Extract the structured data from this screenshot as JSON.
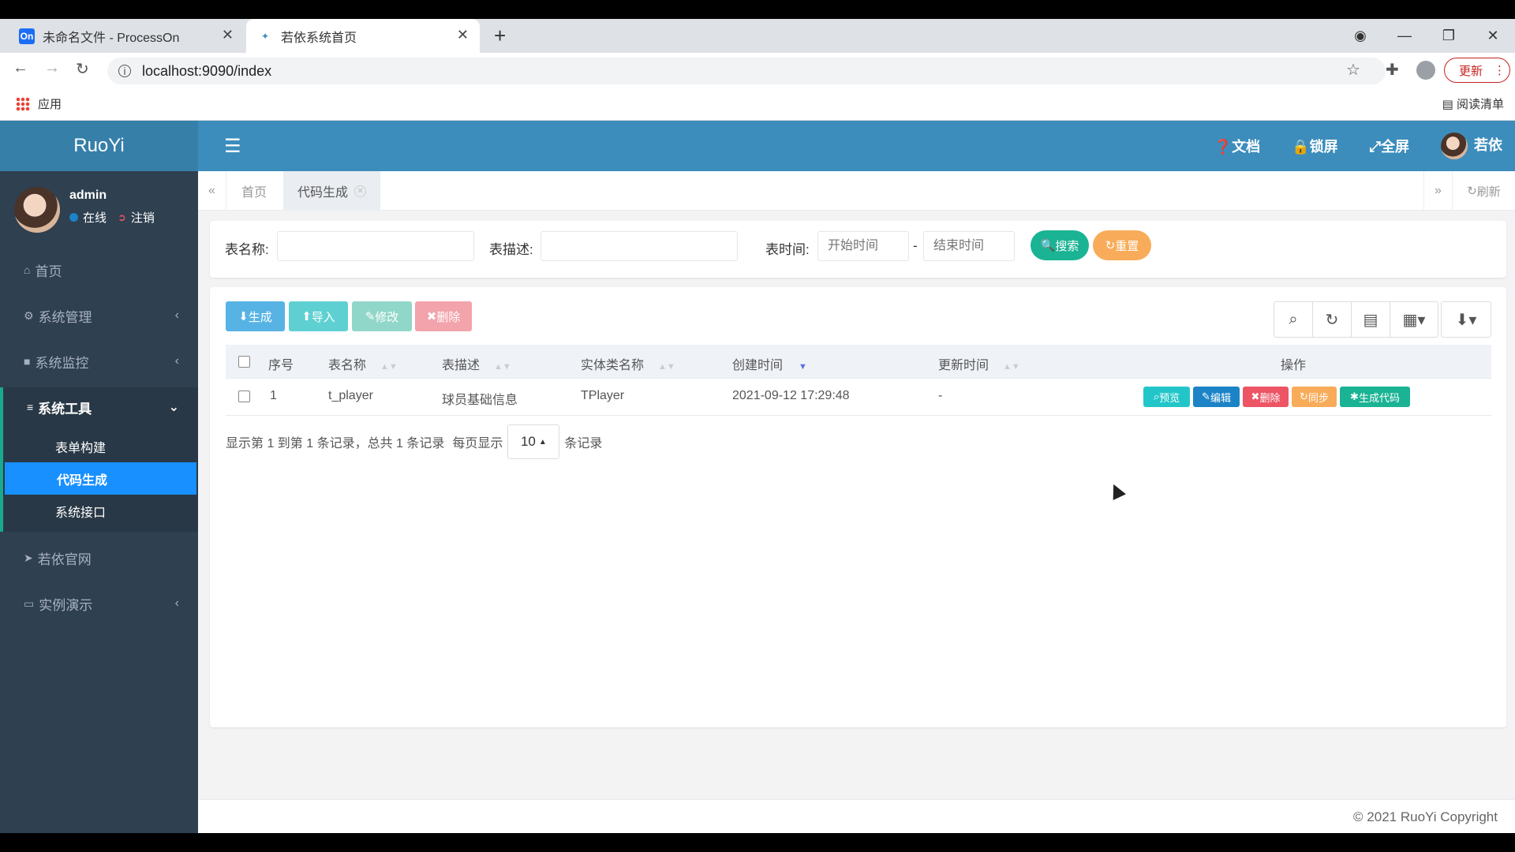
{
  "browser": {
    "tabs": [
      {
        "favicon": "On",
        "title": "未命名文件 - ProcessOn"
      },
      {
        "favicon": "✦",
        "title": "若依系统首页"
      }
    ],
    "url": "localhost:9090/index",
    "update_label": "更新",
    "bookmarks": {
      "apps": "应用",
      "reading_list": "阅读清单"
    }
  },
  "app": {
    "logo": "RuoYi",
    "user": {
      "name": "admin",
      "online": "在线",
      "logout": "注销"
    },
    "menu": [
      {
        "icon": "⌂",
        "label": "首页",
        "arrow": ""
      },
      {
        "icon": "⚙",
        "label": "系统管理",
        "arrow": "‹"
      },
      {
        "icon": "■",
        "label": "系统监控",
        "arrow": "‹"
      },
      {
        "icon": "≡",
        "label": "系统工具",
        "arrow": "⌄"
      },
      {
        "icon": "➤",
        "label": "若依官网",
        "arrow": ""
      },
      {
        "icon": "▭",
        "label": "实例演示",
        "arrow": "‹"
      }
    ],
    "submenu": [
      "表单构建",
      "代码生成",
      "系统接口"
    ],
    "topbar": {
      "docs": "文档",
      "lock": "锁屏",
      "fullscreen": "全屏",
      "username": "若依"
    },
    "page_tabs": {
      "home": "首页",
      "current": "代码生成",
      "refresh": "刷新"
    }
  },
  "search": {
    "table_name_label": "表名称:",
    "table_desc_label": "表描述:",
    "time_label": "表时间:",
    "start_placeholder": "开始时间",
    "end_placeholder": "结束时间",
    "dash": "-",
    "search_button": "搜索",
    "reset_button": "重置"
  },
  "toolbar": {
    "generate": "生成",
    "import": "导入",
    "edit": "修改",
    "delete": "删除"
  },
  "table": {
    "headers": [
      "序号",
      "表名称",
      "表描述",
      "实体类名称",
      "创建时间",
      "更新时间",
      "操作"
    ],
    "rows": [
      {
        "index": "1",
        "table_name": "t_player",
        "table_desc": "球员基础信息",
        "class_name": "TPlayer",
        "create_time": "2021-09-12 17:29:48",
        "update_time": "-"
      }
    ],
    "row_actions": [
      "预览",
      "编辑",
      "删除",
      "同步",
      "生成代码"
    ]
  },
  "pagination": {
    "summary": "显示第 1 到第 1 条记录，总共 1 条记录",
    "per_page_prefix": "每页显示",
    "page_size": "10",
    "per_page_suffix": "条记录"
  },
  "footer": "© 2021 RuoYi Copyright",
  "colors": {
    "sidebar": "#2f4050",
    "topbar": "#3c8dbc",
    "primary": "#1890ff",
    "success": "#1ab394",
    "warning": "#f8ac59",
    "danger": "#ed5565",
    "info": "#23c6c8"
  }
}
